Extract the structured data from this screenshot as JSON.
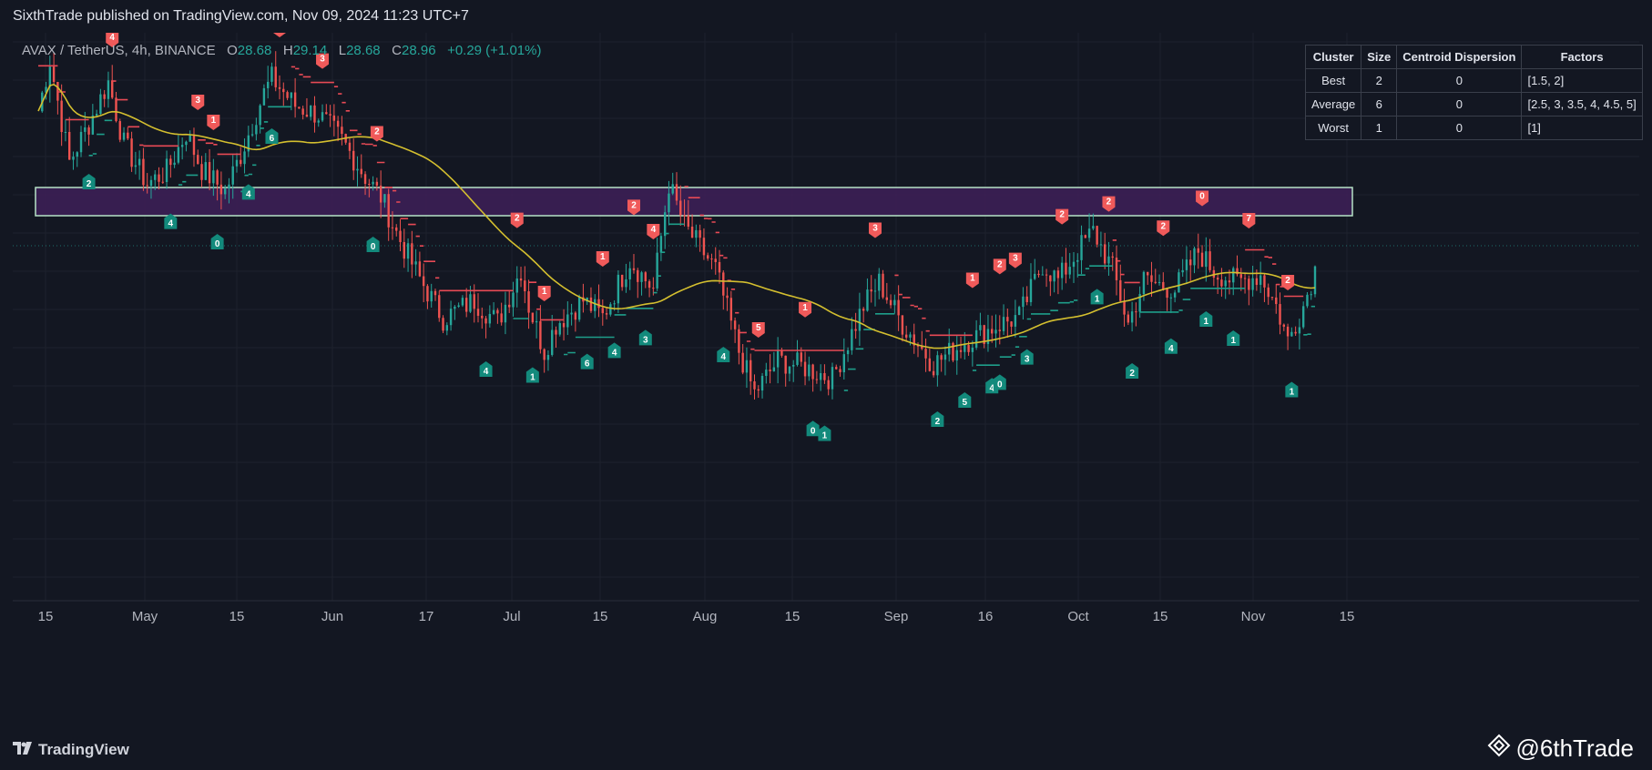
{
  "header": {
    "published_line": "SixthTrade published on TradingView.com, Nov 09, 2024 11:23 UTC+7"
  },
  "legend": {
    "symbol": "AVAX / TetherUS, 4h, BINANCE",
    "o_label": "O",
    "o_value": "28.68",
    "h_label": "H",
    "h_value": "29.14",
    "l_label": "L",
    "l_value": "28.68",
    "c_label": "C",
    "c_value": "28.96",
    "change": "+0.29 (+1.01%)"
  },
  "cluster_table": {
    "headers": [
      "Cluster",
      "Size",
      "Centroid Dispersion",
      "Factors"
    ],
    "rows": [
      {
        "cluster": "Best",
        "size": "2",
        "dispersion": "0",
        "factors": "[1.5, 2]"
      },
      {
        "cluster": "Average",
        "size": "6",
        "dispersion": "0",
        "factors": "[2.5, 3, 3.5, 4, 4.5, 5]"
      },
      {
        "cluster": "Worst",
        "size": "1",
        "dispersion": "0",
        "factors": "[1]"
      }
    ]
  },
  "footer": {
    "brand": "TradingView",
    "signature": "@6thTrade"
  },
  "colors": {
    "background": "#131722",
    "bull": "#26a69a",
    "bear": "#ef5350",
    "trend_red": "#e84a55",
    "trend_teal": "#1e9e8a",
    "ma_yellow": "#d4bf2f",
    "zone_fill": "#3c1f55",
    "zone_border": "#b7e4c7",
    "sell_marker": "#f05a5a",
    "buy_marker": "#138a7c"
  },
  "chart_data": {
    "type": "candlestick",
    "xlabels": [
      "15",
      "May",
      "15",
      "Jun",
      "17",
      "Jul",
      "15",
      "Aug",
      "15",
      "Sep",
      "16",
      "Oct",
      "15",
      "Nov",
      "15"
    ],
    "price_path": [
      [
        0,
        40.2
      ],
      [
        3,
        43.0
      ],
      [
        8,
        37.4
      ],
      [
        13,
        39.5
      ],
      [
        18,
        41.8
      ],
      [
        22,
        38.4
      ],
      [
        28,
        36.2
      ],
      [
        33,
        36.9
      ],
      [
        38,
        39.0
      ],
      [
        42,
        37.0
      ],
      [
        48,
        35.8
      ],
      [
        52,
        37.8
      ],
      [
        58,
        41.2
      ],
      [
        60,
        42.0
      ],
      [
        66,
        40.5
      ],
      [
        72,
        40.0
      ],
      [
        78,
        38.6
      ],
      [
        84,
        36.6
      ],
      [
        88,
        35.5
      ],
      [
        92,
        33.5
      ],
      [
        98,
        31.0
      ],
      [
        104,
        28.8
      ],
      [
        112,
        29.8
      ],
      [
        118,
        28.6
      ],
      [
        124,
        31.5
      ],
      [
        126,
        29.5
      ],
      [
        130,
        27.0
      ],
      [
        133,
        28.5
      ],
      [
        140,
        29.8
      ],
      [
        145,
        28.9
      ],
      [
        152,
        32.0
      ],
      [
        158,
        30.4
      ],
      [
        162,
        36.2
      ],
      [
        166,
        33.9
      ],
      [
        174,
        31.5
      ],
      [
        180,
        27.0
      ],
      [
        184,
        24.7
      ],
      [
        190,
        26.5
      ],
      [
        196,
        26.2
      ],
      [
        204,
        25.5
      ],
      [
        212,
        29.5
      ],
      [
        216,
        30.8
      ],
      [
        222,
        28.5
      ],
      [
        230,
        26.3
      ],
      [
        238,
        27.5
      ],
      [
        246,
        28.4
      ],
      [
        252,
        28.9
      ],
      [
        258,
        31.8
      ],
      [
        262,
        30.9
      ],
      [
        268,
        32.8
      ],
      [
        271,
        33.6
      ],
      [
        276,
        31.5
      ],
      [
        280,
        28.5
      ],
      [
        284,
        30.9
      ],
      [
        292,
        30.4
      ],
      [
        298,
        32.5
      ],
      [
        302,
        31.4
      ],
      [
        308,
        30.8
      ],
      [
        314,
        31.2
      ],
      [
        318,
        29.5
      ],
      [
        321,
        27.6
      ],
      [
        325,
        29.5
      ],
      [
        328,
        31.5
      ]
    ]
  }
}
